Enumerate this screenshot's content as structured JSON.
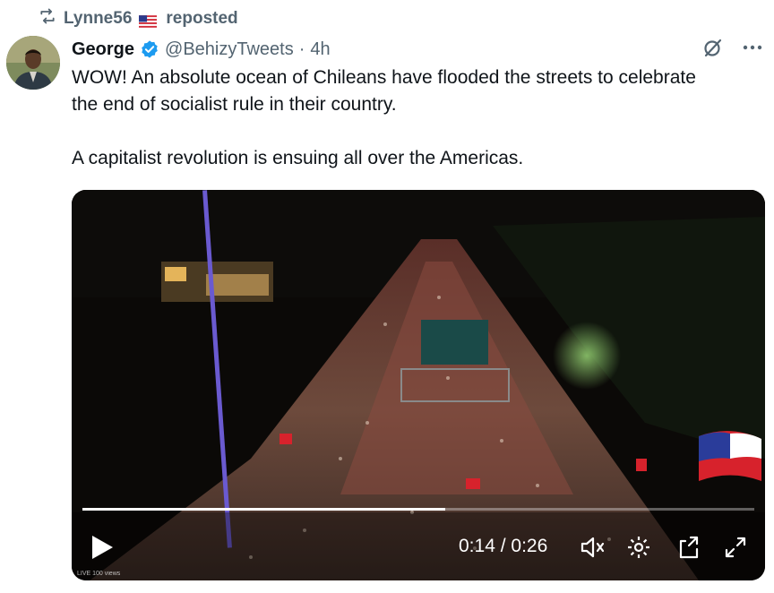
{
  "repost": {
    "user": "Lynne56",
    "label": "reposted"
  },
  "author": {
    "name": "George",
    "handle": "@BehizyTweets",
    "separator": "·",
    "age": "4h"
  },
  "tweet": {
    "line1": "WOW! An absolute ocean of Chileans have flooded the streets to celebrate",
    "line2": "the end of socialist rule in their country.",
    "line3": "A capitalist revolution is ensuing all over the Americas."
  },
  "video": {
    "current_time": "0:14",
    "time_separator": " / ",
    "duration": "0:26",
    "progress_fraction": 0.54,
    "overlay_tag": "LIVE  100 views"
  },
  "colors": {
    "accent": "#1d9bf0",
    "muted": "#536471",
    "text": "#0f1419"
  }
}
